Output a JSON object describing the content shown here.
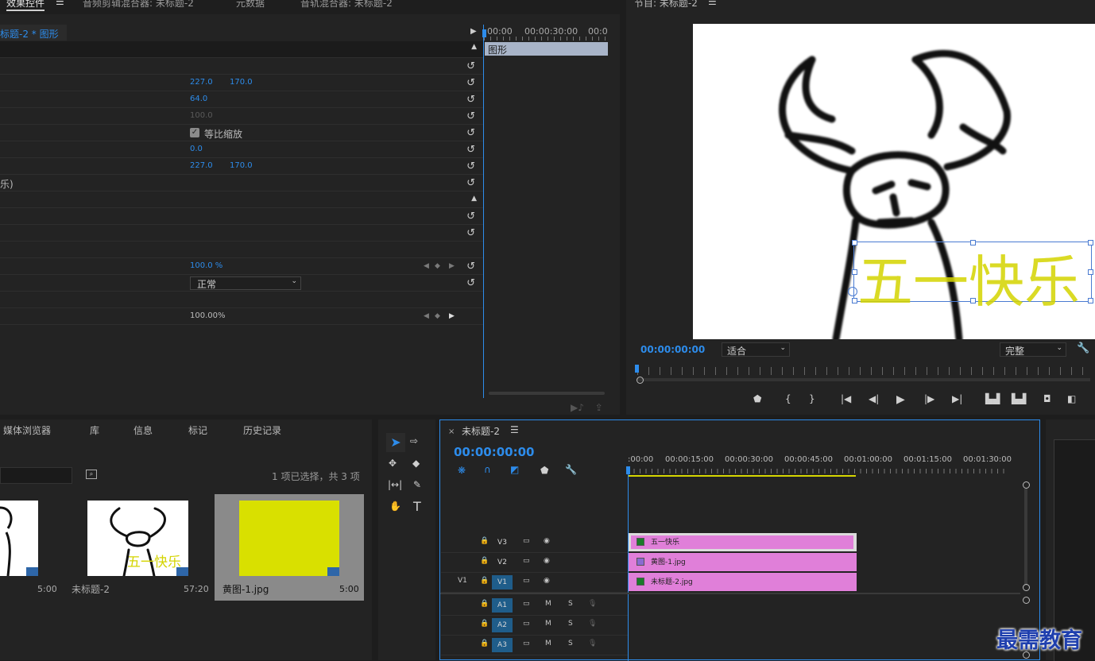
{
  "effect_panel": {
    "tabs": [
      "效果控件",
      "音频剪辑混合器: 未标题-2",
      "元数据",
      "音轨混合器: 未标题-2"
    ],
    "clip_label": "标题-2 * 图形",
    "timeline_graphic_label": "图形",
    "ruler": [
      "00:00",
      "00:00:30:00",
      "00:0"
    ],
    "values": {
      "position_x": "227.0",
      "position_y": "170.0",
      "scale": "64.0",
      "scale_width": "100.0",
      "uniform_scale": "等比缩放",
      "rotation": "0.0",
      "anchor_x": "227.0",
      "anchor_y": "170.0",
      "text_fragment": "乐)",
      "opacity": "100.0 %",
      "blend_mode": "正常",
      "speed": "100.00%"
    }
  },
  "program_monitor": {
    "title": "节目: 未标题-2",
    "timecode": "00:00:00:00",
    "fit": "适合",
    "quality": "完整",
    "overlay_text": "五一快乐"
  },
  "project_panel": {
    "tabs": [
      "媒体浏览器",
      "库",
      "信息",
      "标记",
      "历史记录"
    ],
    "selection_info": "1 项已选择，共 3 项",
    "items": [
      {
        "name": "",
        "duration": "5:00"
      },
      {
        "name": "未标题-2",
        "duration": "57:20",
        "overlay": "五一快乐"
      },
      {
        "name": "黄图-1.jpg",
        "duration": "5:00",
        "color": "#d9e000"
      }
    ]
  },
  "timeline": {
    "title": "未标题-2",
    "timecode": "00:00:00:00",
    "ruler": [
      ":00:00",
      "00:00:15:00",
      "00:00:30:00",
      "00:00:45:00",
      "00:01:00:00",
      "00:01:15:00",
      "00:01:30:00"
    ],
    "tracks": [
      {
        "src": "",
        "name": "V3",
        "clip": "五一快乐"
      },
      {
        "src": "",
        "name": "V2",
        "clip": "黄图-1.jpg"
      },
      {
        "src": "V1",
        "name": "V1",
        "clip": "未标题-2.jpg"
      },
      {
        "src": "",
        "name": "A1",
        "m": "M",
        "s": "S"
      },
      {
        "src": "",
        "name": "A2",
        "m": "M",
        "s": "S"
      },
      {
        "src": "",
        "name": "A3",
        "m": "M",
        "s": "S"
      }
    ]
  },
  "watermark": "最需教育",
  "colors": {
    "accent": "#2d8ceb",
    "clip": "#e07fd9",
    "yellow_image": "#d9e000",
    "text_overlay": "#d4d400"
  }
}
